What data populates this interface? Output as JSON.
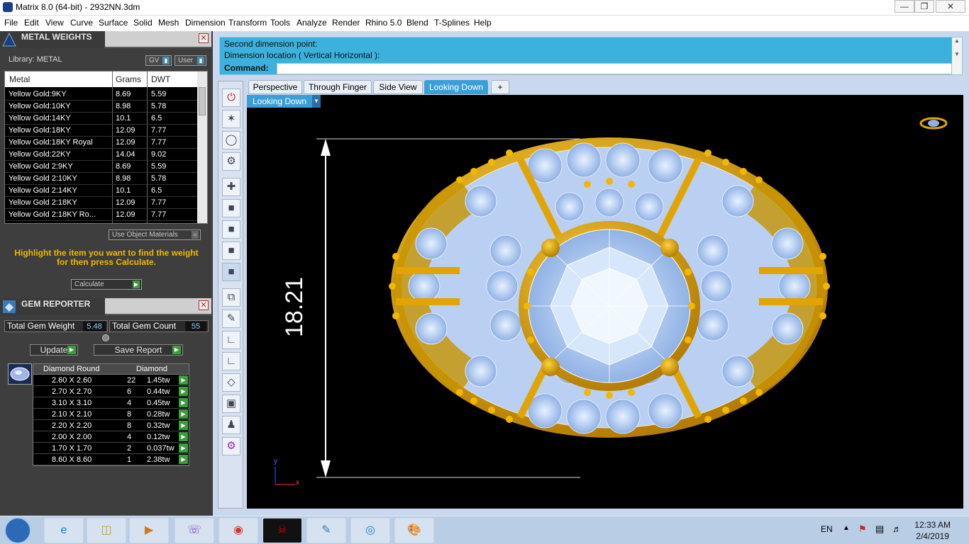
{
  "window": {
    "title": "Matrix 8.0 (64-bit) - 2932NN.3dm"
  },
  "menu": [
    "File",
    "Edit",
    "View",
    "Curve",
    "Surface",
    "Solid",
    "Mesh",
    "Dimension",
    "Transform",
    "Tools",
    "Analyze",
    "Render",
    "Rhino 5.0",
    "Blend",
    "T-Splines",
    "Help"
  ],
  "metal_weights": {
    "title": "METAL WEIGHTS",
    "library_label": "Library: METAL",
    "gv_label": "GV",
    "user_label": "User",
    "columns": [
      "Metal",
      "Grams",
      "DWT"
    ],
    "rows": [
      [
        "Yellow Gold:9KY",
        "8.69",
        "5.59"
      ],
      [
        "Yellow Gold:10KY",
        "8.98",
        "5.78"
      ],
      [
        "Yellow Gold:14KY",
        "10.1",
        "6.5"
      ],
      [
        "Yellow Gold:18KY",
        "12.09",
        "7.77"
      ],
      [
        "Yellow Gold:18KY Royal",
        "12.09",
        "7.77"
      ],
      [
        "Yellow Gold:22KY",
        "14.04",
        "9.02"
      ],
      [
        "Yellow Gold 2:9KY",
        "8.69",
        "5.59"
      ],
      [
        "Yellow Gold 2:10KY",
        "8.98",
        "5.78"
      ],
      [
        "Yellow Gold 2:14KY",
        "10.1",
        "6.5"
      ],
      [
        "Yellow Gold 2:18KY",
        "12.09",
        "7.77"
      ],
      [
        "Yellow Gold 2:18KY Ro...",
        "12.09",
        "7.77"
      ]
    ],
    "use_object_materials": "Use Object Materials",
    "hint": "Highlight the item you want to find the weight for then press Calculate.",
    "calculate_label": "Calculate"
  },
  "gem_reporter": {
    "title": "GEM REPORTER",
    "total_weight_label": "Total Gem Weight",
    "total_weight_value": "5.48",
    "total_count_label": "Total Gem Count",
    "total_count_value": "55",
    "update_label": "Update",
    "save_report_label": "Save Report",
    "col_shape": "Diamond Round",
    "col_material": "Diamond",
    "rows": [
      [
        "2.60 X 2.60",
        "22",
        "1.45tw"
      ],
      [
        "2.70 X 2.70",
        "6",
        "0.44tw"
      ],
      [
        "3.10 X 3.10",
        "4",
        "0.45tw"
      ],
      [
        "2.10 X 2.10",
        "8",
        "0.28tw"
      ],
      [
        "2.20 X 2.20",
        "8",
        "0.32tw"
      ],
      [
        "2.00 X 2.00",
        "4",
        "0.12tw"
      ],
      [
        "1.70 X 1.70",
        "2",
        "0.037tw"
      ],
      [
        "8.60 X 8.60",
        "1",
        "2.38tw"
      ]
    ]
  },
  "command": {
    "line1": "Second dimension point:",
    "line2": "Dimension location ( Vertical  Horizontal ):",
    "prompt": "Command:"
  },
  "tabs": [
    "Perspective",
    "Through Finger",
    "Side View",
    "Looking Down",
    "+"
  ],
  "viewport": {
    "label": "Looking Down",
    "dimension": "18.21",
    "axis_y": "y",
    "axis_x": "x"
  },
  "taskbar": {
    "lang": "EN",
    "time": "12:33 AM",
    "date": "2/4/2019"
  },
  "colors": {
    "accent": "#3a9fd8",
    "gold": "#e2a400",
    "gem": "#aac8f0",
    "hint": "#f0b800"
  }
}
